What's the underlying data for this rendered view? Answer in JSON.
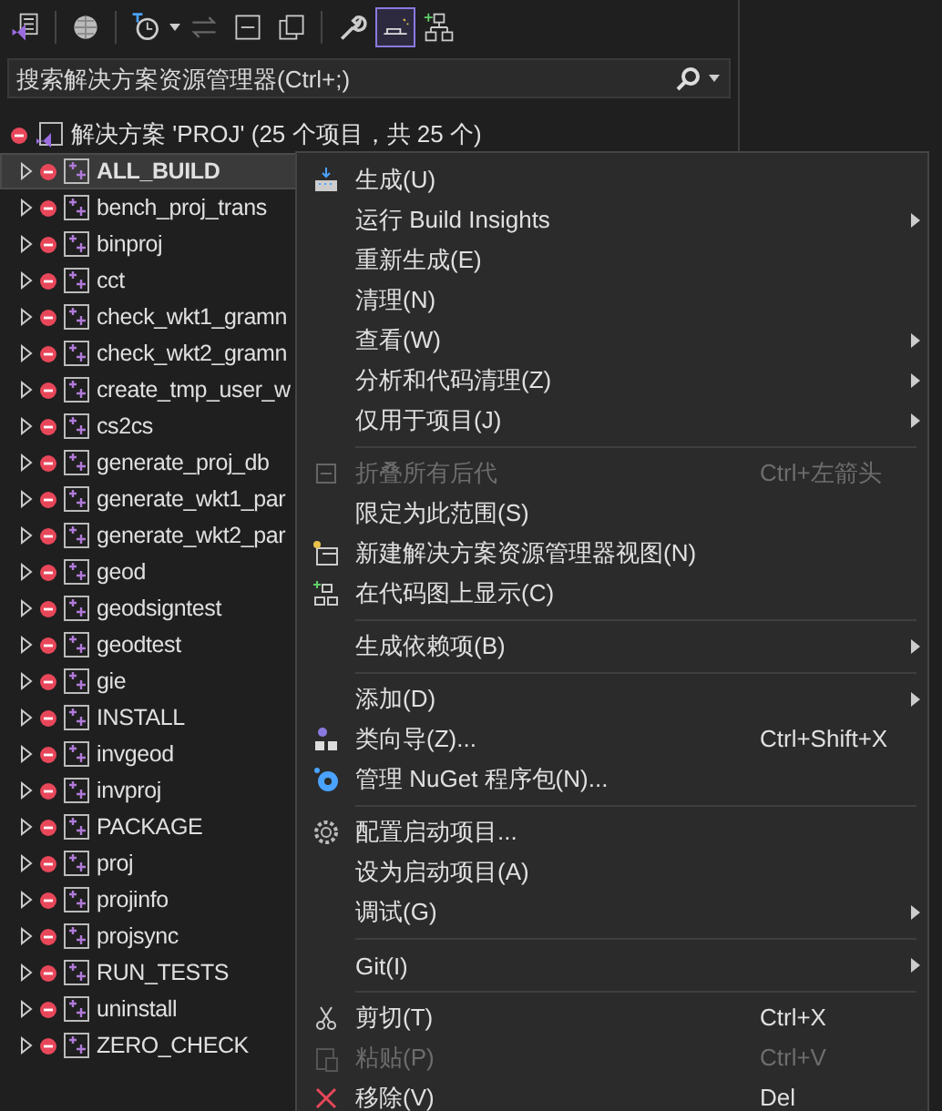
{
  "toolbar": {
    "buttons": [
      {
        "selected": false
      },
      {
        "selected": false
      },
      {
        "selected": false
      },
      {
        "selected": false
      },
      {
        "selected": false
      },
      {
        "selected": false
      },
      {
        "selected": false
      },
      {
        "selected": true
      },
      {
        "selected": false
      }
    ]
  },
  "search": {
    "placeholder": "搜索解决方案资源管理器(Ctrl+;)"
  },
  "solution": {
    "label": "解决方案 'PROJ' (25 个项目，共 25 个)"
  },
  "tree": [
    {
      "label": "ALL_BUILD",
      "selected": true
    },
    {
      "label": "bench_proj_trans",
      "selected": false
    },
    {
      "label": "binproj",
      "selected": false
    },
    {
      "label": "cct",
      "selected": false
    },
    {
      "label": "check_wkt1_gramn",
      "selected": false
    },
    {
      "label": "check_wkt2_gramn",
      "selected": false
    },
    {
      "label": "create_tmp_user_w",
      "selected": false
    },
    {
      "label": "cs2cs",
      "selected": false
    },
    {
      "label": "generate_proj_db",
      "selected": false
    },
    {
      "label": "generate_wkt1_par",
      "selected": false
    },
    {
      "label": "generate_wkt2_par",
      "selected": false
    },
    {
      "label": "geod",
      "selected": false
    },
    {
      "label": "geodsigntest",
      "selected": false
    },
    {
      "label": "geodtest",
      "selected": false
    },
    {
      "label": "gie",
      "selected": false
    },
    {
      "label": "INSTALL",
      "selected": false
    },
    {
      "label": "invgeod",
      "selected": false
    },
    {
      "label": "invproj",
      "selected": false
    },
    {
      "label": "PACKAGE",
      "selected": false
    },
    {
      "label": "proj",
      "selected": false
    },
    {
      "label": "projinfo",
      "selected": false
    },
    {
      "label": "projsync",
      "selected": false
    },
    {
      "label": "RUN_TESTS",
      "selected": false
    },
    {
      "label": "uninstall",
      "selected": false
    },
    {
      "label": "ZERO_CHECK",
      "selected": false
    }
  ],
  "context_menu": [
    {
      "kind": "item",
      "label": "生成(U)",
      "disabled": false,
      "submenu": false
    },
    {
      "kind": "item",
      "label": "运行 Build Insights",
      "disabled": false,
      "submenu": true
    },
    {
      "kind": "item",
      "label": "重新生成(E)",
      "disabled": false,
      "submenu": false
    },
    {
      "kind": "item",
      "label": "清理(N)",
      "disabled": false,
      "submenu": false
    },
    {
      "kind": "item",
      "label": "查看(W)",
      "disabled": false,
      "submenu": true
    },
    {
      "kind": "item",
      "label": "分析和代码清理(Z)",
      "disabled": false,
      "submenu": true
    },
    {
      "kind": "item",
      "label": "仅用于项目(J)",
      "disabled": false,
      "submenu": true
    },
    {
      "kind": "separator"
    },
    {
      "kind": "item",
      "label": "折叠所有后代",
      "shortcut": "Ctrl+左箭头",
      "disabled": true,
      "submenu": false
    },
    {
      "kind": "item",
      "label": "限定为此范围(S)",
      "disabled": false,
      "submenu": false
    },
    {
      "kind": "item",
      "label": "新建解决方案资源管理器视图(N)",
      "disabled": false,
      "submenu": false
    },
    {
      "kind": "item",
      "label": "在代码图上显示(C)",
      "disabled": false,
      "submenu": false
    },
    {
      "kind": "separator"
    },
    {
      "kind": "item",
      "label": "生成依赖项(B)",
      "disabled": false,
      "submenu": true
    },
    {
      "kind": "separator"
    },
    {
      "kind": "item",
      "label": "添加(D)",
      "disabled": false,
      "submenu": true
    },
    {
      "kind": "item",
      "label": "类向导(Z)...",
      "shortcut": "Ctrl+Shift+X",
      "disabled": false,
      "submenu": false
    },
    {
      "kind": "item",
      "label": "管理 NuGet 程序包(N)...",
      "disabled": false,
      "submenu": false
    },
    {
      "kind": "separator"
    },
    {
      "kind": "item",
      "label": "配置启动项目...",
      "disabled": false,
      "submenu": false
    },
    {
      "kind": "item",
      "label": "设为启动项目(A)",
      "disabled": false,
      "submenu": false
    },
    {
      "kind": "item",
      "label": "调试(G)",
      "disabled": false,
      "submenu": true
    },
    {
      "kind": "separator"
    },
    {
      "kind": "item",
      "label": "Git(I)",
      "disabled": false,
      "submenu": true
    },
    {
      "kind": "separator"
    },
    {
      "kind": "item",
      "label": "剪切(T)",
      "shortcut": "Ctrl+X",
      "disabled": false,
      "submenu": false
    },
    {
      "kind": "item",
      "label": "粘贴(P)",
      "shortcut": "Ctrl+V",
      "disabled": true,
      "submenu": false
    },
    {
      "kind": "item",
      "label": "移除(V)",
      "shortcut": "Del",
      "disabled": false,
      "submenu": false
    }
  ]
}
